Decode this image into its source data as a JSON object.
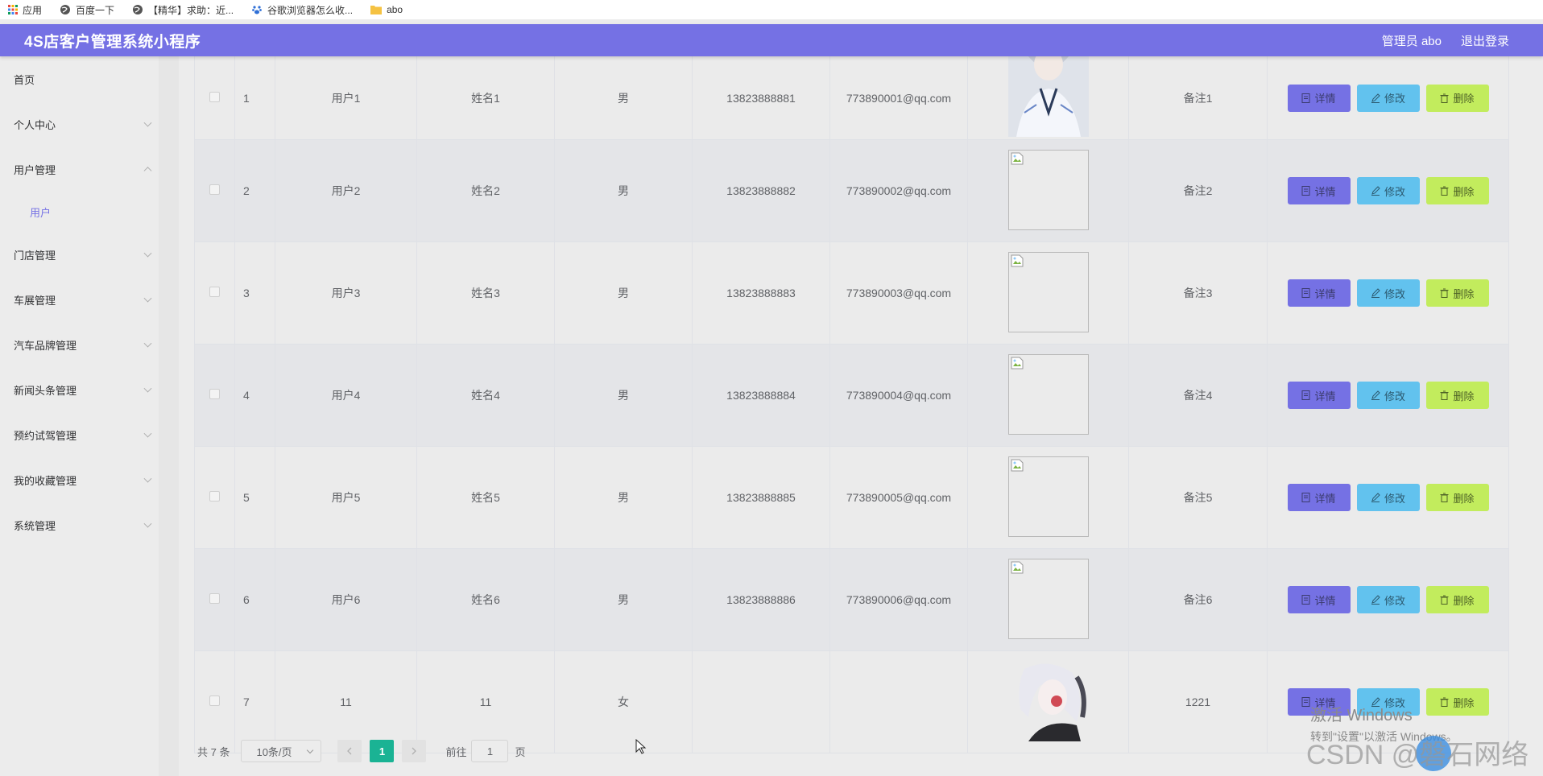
{
  "bookmarks": [
    {
      "label": "应用",
      "icon": "apps-grid-icon"
    },
    {
      "label": "百度一下",
      "icon": "globe-icon"
    },
    {
      "label": "【精华】求助：近...",
      "icon": "globe-icon"
    },
    {
      "label": "谷歌浏览器怎么收...",
      "icon": "paw-icon"
    },
    {
      "label": "abo",
      "icon": "folder-icon"
    }
  ],
  "header": {
    "title": "4S店客户管理系统小程序",
    "admin_label": "管理员 abo",
    "logout_label": "退出登录",
    "color": "#7571e4"
  },
  "sidebar": {
    "items": [
      {
        "label": "首页",
        "expandable": false
      },
      {
        "label": "个人中心",
        "expandable": true
      },
      {
        "label": "用户管理",
        "expandable": true,
        "expanded": true,
        "children": [
          {
            "label": "用户"
          }
        ]
      },
      {
        "label": "门店管理",
        "expandable": true
      },
      {
        "label": "车展管理",
        "expandable": true
      },
      {
        "label": "汽车品牌管理",
        "expandable": true
      },
      {
        "label": "新闻头条管理",
        "expandable": true
      },
      {
        "label": "预约试驾管理",
        "expandable": true
      },
      {
        "label": "我的收藏管理",
        "expandable": true
      },
      {
        "label": "系统管理",
        "expandable": true
      }
    ]
  },
  "actions": {
    "detail": "详情",
    "edit": "修改",
    "delete": "删除"
  },
  "table": {
    "rows": [
      {
        "index": "1",
        "account": "用户1",
        "name": "姓名1",
        "gender": "男",
        "phone": "13823888881",
        "email": "773890001@qq.com",
        "photo": "avatar-male",
        "note": "备注1"
      },
      {
        "index": "2",
        "account": "用户2",
        "name": "姓名2",
        "gender": "男",
        "phone": "13823888882",
        "email": "773890002@qq.com",
        "photo": "broken",
        "note": "备注2"
      },
      {
        "index": "3",
        "account": "用户3",
        "name": "姓名3",
        "gender": "男",
        "phone": "13823888883",
        "email": "773890003@qq.com",
        "photo": "broken",
        "note": "备注3"
      },
      {
        "index": "4",
        "account": "用户4",
        "name": "姓名4",
        "gender": "男",
        "phone": "13823888884",
        "email": "773890004@qq.com",
        "photo": "broken",
        "note": "备注4"
      },
      {
        "index": "5",
        "account": "用户5",
        "name": "姓名5",
        "gender": "男",
        "phone": "13823888885",
        "email": "773890005@qq.com",
        "photo": "broken",
        "note": "备注5"
      },
      {
        "index": "6",
        "account": "用户6",
        "name": "姓名6",
        "gender": "男",
        "phone": "13823888886",
        "email": "773890006@qq.com",
        "photo": "broken",
        "note": "备注6"
      },
      {
        "index": "7",
        "account": "11",
        "name": "11",
        "gender": "女",
        "phone": "",
        "email": "",
        "photo": "avatar-female",
        "note": "1221"
      }
    ]
  },
  "pagination": {
    "total": "共 7 条",
    "page_size": "10条/页",
    "current_page": "1",
    "goto_label": "前往",
    "goto_value": "1",
    "page_suffix": "页"
  },
  "watermark": {
    "line1": "激活 Windows",
    "line2": "转到\"设置\"以激活 Windows。",
    "csdn": "CSDN @磐石网络"
  }
}
